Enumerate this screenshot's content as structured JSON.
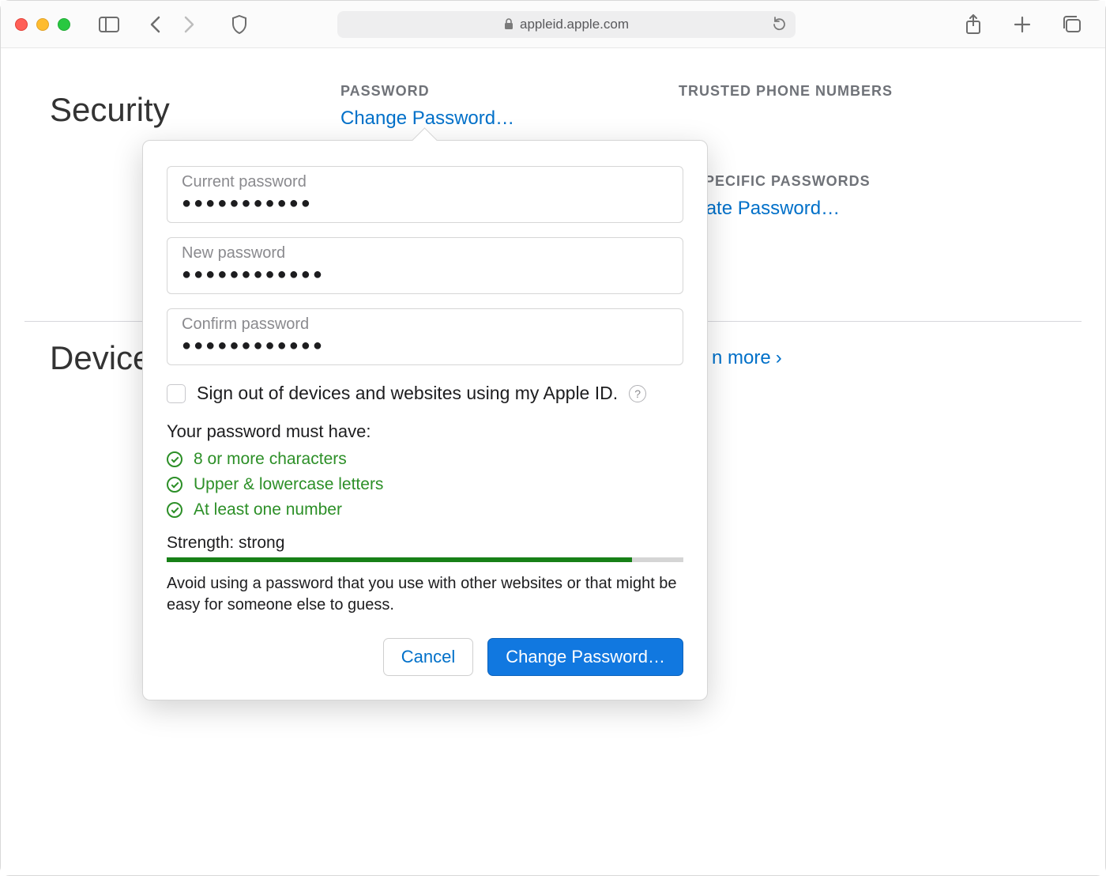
{
  "browser": {
    "url": "appleid.apple.com"
  },
  "page": {
    "security_title": "Security",
    "devices_title": "Devices",
    "learn_more": "n more"
  },
  "sections": {
    "password": {
      "header": "PASSWORD",
      "link": "Change Password…"
    },
    "trusted_phone": {
      "header": "TRUSTED PHONE NUMBERS"
    },
    "app_specific": {
      "header": "P-SPECIFIC PASSWORDS",
      "link": "nerate Password…"
    }
  },
  "popover": {
    "current_label": "Current password",
    "current_value": "●●●●●●●●●●●",
    "new_label": "New password",
    "new_value": "●●●●●●●●●●●●",
    "confirm_label": "Confirm password",
    "confirm_value": "●●●●●●●●●●●●",
    "signout_label": "Sign out of devices and websites using my Apple ID.",
    "requirements_title": "Your password must have:",
    "requirements": {
      "r1": "8 or more characters",
      "r2": "Upper & lowercase letters",
      "r3": "At least one number"
    },
    "strength_label": "Strength: strong",
    "strength_percent": 90,
    "advice": "Avoid using a password that you use with other websites or that might be easy for someone else to guess.",
    "cancel": "Cancel",
    "submit": "Change Password…",
    "help_glyph": "?"
  },
  "chevron_glyph": "›"
}
